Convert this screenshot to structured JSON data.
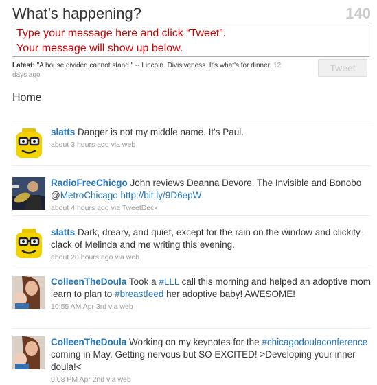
{
  "compose": {
    "title": "What’s happening?",
    "counter": "140",
    "line1": "Type your message here and click “Tweet”.",
    "line2": "Your message will show up below."
  },
  "latest": {
    "label": "Latest:",
    "text": " \"A house divided cannot stand.\" -- Lincoln. Divisiveness. It's what's for dinner.",
    "ago": " 12 days ago"
  },
  "tweet_button": "Tweet",
  "timeline_title": "Home",
  "tweets": [
    {
      "user": "slatts",
      "text": " Danger is not my middle name. It's Paul.",
      "meta": "about 3 hours ago via web",
      "avatar": "lego-head"
    },
    {
      "user": "RadioFreeChicgo",
      "text_a": " John reviews Deanna Devore, The Invisible and Bonobo @",
      "mention": "MetroChicago",
      "text_b": " ",
      "url": "http://bit.ly/9D6epW",
      "meta": "about 4 hours ago via TweetDeck",
      "avatar": "photo-musician"
    },
    {
      "user": "slatts",
      "text": " Dark, dreary, and quiet, except for the rain on the window and clickity-clack of Melinda and me writing this evening.",
      "meta": "about 20 hours ago via web",
      "avatar": "lego-head"
    },
    {
      "user": "ColleenTheDoula",
      "text_a": " Took a ",
      "tag1": "#LLL",
      "text_b": " call this morning and helped an adoptive mom learn to plan to ",
      "tag2": "#breastfeed",
      "text_c": " her adoptive baby! AWESOME!",
      "meta": "10:55 AM Apr 3rd via web",
      "avatar": "photo-mother-baby"
    },
    {
      "user": "ColleenTheDoula",
      "text_a": " Working on my keynotes for the ",
      "tag1": "#chicagodoulaconference",
      "text_b": " coming in May. Getting nervous but SO EXCITED! >Developing your inner doula!<",
      "meta": "9:08 PM Apr 2nd via web",
      "avatar": "photo-mother-baby"
    }
  ]
}
